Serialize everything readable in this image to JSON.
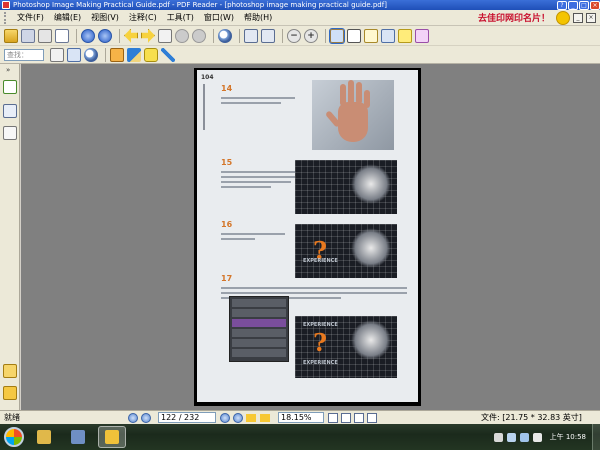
{
  "window": {
    "title": "Photoshop Image Making Practical Guide.pdf - PDF Reader - [photoshop image making practical guide.pdf]",
    "controls": {
      "help": "?",
      "minimize": "_",
      "restore": "□",
      "close": "×"
    }
  },
  "menu": {
    "items": [
      "文件(F)",
      "编辑(E)",
      "视图(V)",
      "注释(C)",
      "工具(T)",
      "窗口(W)",
      "帮助(H)"
    ],
    "promo_text": "去佳印网印名片！",
    "mini_buttons": [
      "_",
      "×"
    ]
  },
  "toolbar": {
    "search_placeholder": "查找："
  },
  "document": {
    "page_number_print": "104",
    "steps": [
      "14",
      "15",
      "16",
      "17"
    ],
    "art_text_1": "EXPERIENCE",
    "art_text_2": "EXPERIENCE",
    "art_text_3": "EXPERIENCE"
  },
  "status": {
    "ready": "就绪",
    "page_field": "122 / 232",
    "zoom": "18.15%",
    "doc_size": "文件: [21.75 * 32.83 英寸]"
  },
  "taskbar": {
    "time": "上午 10:58"
  },
  "colors": {
    "accent": "#316ac5",
    "title_bar": "#1f4fb8",
    "chrome": "#ece9d8",
    "doc_background": "#808080",
    "step_number": "#d4762a",
    "promo": "#c8102e"
  },
  "icons": {
    "toolbar1": [
      "open-folder-icon",
      "save-icon",
      "print-icon",
      "email-icon",
      "page-up-icon",
      "page-down-icon",
      "back-icon",
      "forward-icon",
      "multiple-pages-icon",
      "undo-icon",
      "redo-icon",
      "zoom-icon",
      "fit-page-icon",
      "fit-width-icon",
      "zoom-out-icon",
      "zoom-in-icon",
      "hand-tool-icon",
      "text-select-icon",
      "select-icon",
      "snapshot-icon",
      "note-icon",
      "highlight-icon"
    ],
    "toolbar2": [
      "stamp-icon",
      "pencil-icon",
      "comment-icon",
      "arrow-icon"
    ]
  }
}
